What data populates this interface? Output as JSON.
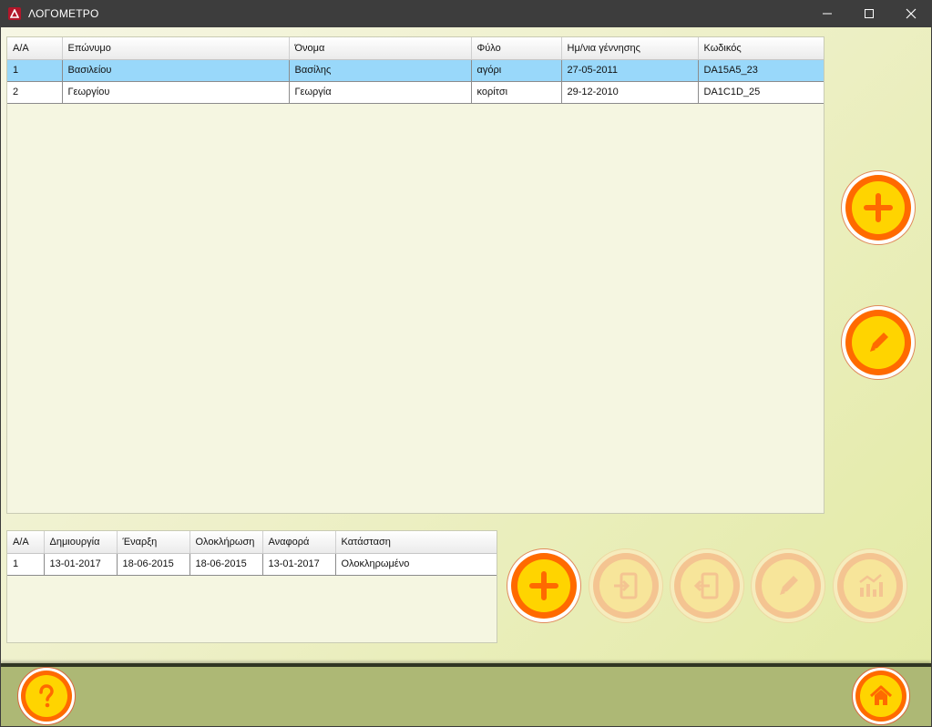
{
  "window": {
    "title": "ΛΟΓΟΜΕΤΡΟ"
  },
  "students_table": {
    "columns": [
      "Α/Α",
      "Επώνυμο",
      "Όνομα",
      "Φύλο",
      "Ημ/νια γέννησης",
      "Κωδικός"
    ],
    "rows": [
      [
        "1",
        "Βασιλείου",
        "Βασίλης",
        "αγόρι",
        "27-05-2011",
        "DA15A5_23"
      ],
      [
        "2",
        "Γεωργίου",
        "Γεωργία",
        "κορίτσι",
        "29-12-2010",
        "DA1C1D_25"
      ]
    ],
    "selected_row": 1
  },
  "sessions_table": {
    "columns": [
      "Α/Α",
      "Δημιουργία",
      "Έναρξη",
      "Ολοκλήρωση",
      "Αναφορά",
      "Κατάσταση"
    ],
    "rows": [
      [
        "1",
        "13-01-2017",
        "18-06-2015",
        "18-06-2015",
        "13-01-2017",
        "Ολοκληρωμένο"
      ]
    ]
  },
  "buttons": {
    "add_student": {
      "icon": "plus-icon",
      "enabled": true
    },
    "edit_student": {
      "icon": "pencil-icon",
      "enabled": true
    },
    "add_session": {
      "icon": "plus-icon",
      "enabled": true
    },
    "import_session": {
      "icon": "tablet-import-icon",
      "enabled": false
    },
    "export_session": {
      "icon": "tablet-export-icon",
      "enabled": false
    },
    "edit_session": {
      "icon": "pencil-icon",
      "enabled": false
    },
    "session_report": {
      "icon": "chart-icon",
      "enabled": false
    },
    "help": {
      "icon": "question-icon",
      "enabled": true
    },
    "home": {
      "icon": "home-icon",
      "enabled": true
    }
  },
  "colors": {
    "accent_orange": "#ff6a00",
    "accent_yellow": "#ffd400",
    "selection": "#99d8fa"
  }
}
